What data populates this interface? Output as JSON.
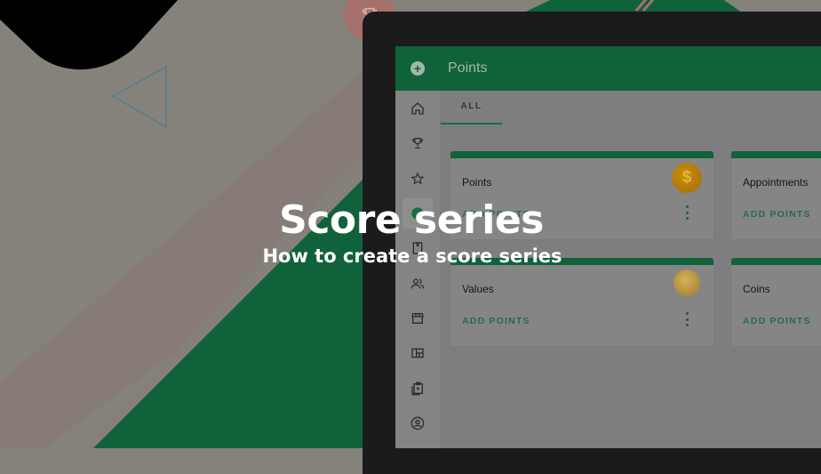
{
  "overlay": {
    "title": "Score series",
    "subtitle": "How to create a score series"
  },
  "app": {
    "title": "Points",
    "logo_icon": "add-circle-icon",
    "accent_color": "#10623a"
  },
  "sidebar": {
    "items": [
      {
        "icon": "home-icon"
      },
      {
        "icon": "trophy-icon"
      },
      {
        "icon": "star-icon"
      },
      {
        "icon": "points-icon",
        "active": true
      },
      {
        "icon": "book-icon"
      },
      {
        "icon": "people-icon"
      },
      {
        "icon": "store-icon"
      },
      {
        "icon": "dashboard-icon"
      },
      {
        "icon": "clipboard-play-icon"
      },
      {
        "icon": "account-circle-icon"
      }
    ]
  },
  "tabs": [
    {
      "label": "ALL",
      "active": true
    }
  ],
  "cards": [
    {
      "title": "Points",
      "action": "ADD POINTS",
      "icon": "dollar-coin-icon",
      "icon_text": "$"
    },
    {
      "title": "Appointments",
      "action": "ADD POINTS"
    },
    {
      "title": "Values",
      "action": "ADD POINTS",
      "icon": "gold-coin-icon"
    },
    {
      "title": "Coins",
      "action": "ADD POINTS"
    }
  ]
}
